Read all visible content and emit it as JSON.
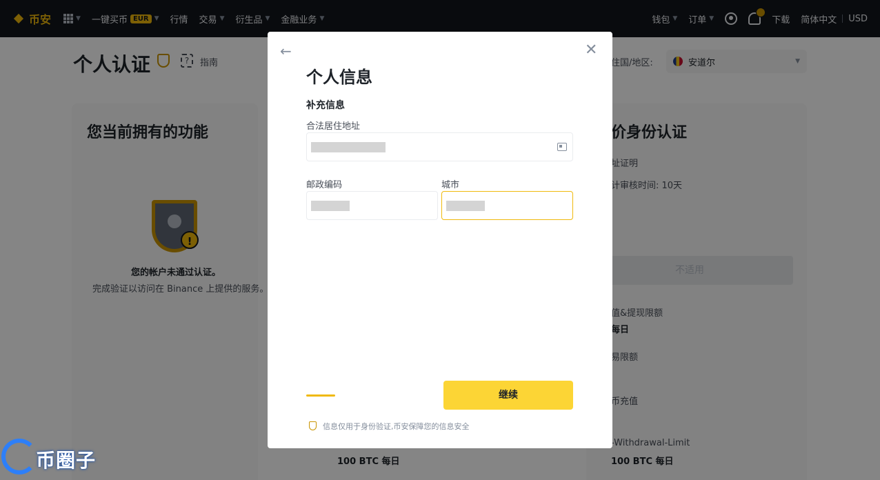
{
  "nav": {
    "brand": "币安",
    "buy_crypto": "一键买币",
    "eur_badge": "EUR",
    "markets": "行情",
    "trade": "交易",
    "derivatives": "衍生品",
    "finance": "金融业务",
    "wallet": "钱包",
    "orders": "订单",
    "download": "下载",
    "language": "简体中文",
    "currency": "USD"
  },
  "page": {
    "title": "个人认证",
    "guide": "指南",
    "country_label": "住国/地区:",
    "country_value": "安道尔",
    "left_card": {
      "title": "您当前拥有的功能",
      "status": "您的帐户未通过认证。",
      "status_sub": "完成验证以访问在 Binance 上提供的服务。",
      "limit": "100 BTC 每日"
    },
    "right_card": {
      "title": "价身份认证",
      "line1": "址证明",
      "line2": "计审核时间: 10天",
      "button": "不适用",
      "limit1_label": "值&提现限额",
      "limit1_value": "每日",
      "limit2_label": "易限额",
      "limit3_label": "币充值",
      "limit4_label": "-Withdrawal-Limit",
      "limit4_value": "100 BTC 每日"
    }
  },
  "modal": {
    "title": "个人信息",
    "section": "补充信息",
    "address_label": "合法居住地址",
    "postal_label": "邮政编码",
    "city_label": "城市",
    "continue": "继续",
    "footer_note": "信息仅用于身份验证,币安保障您的信息安全",
    "progress_fraction": 0.25
  },
  "watermark": "币圈子"
}
